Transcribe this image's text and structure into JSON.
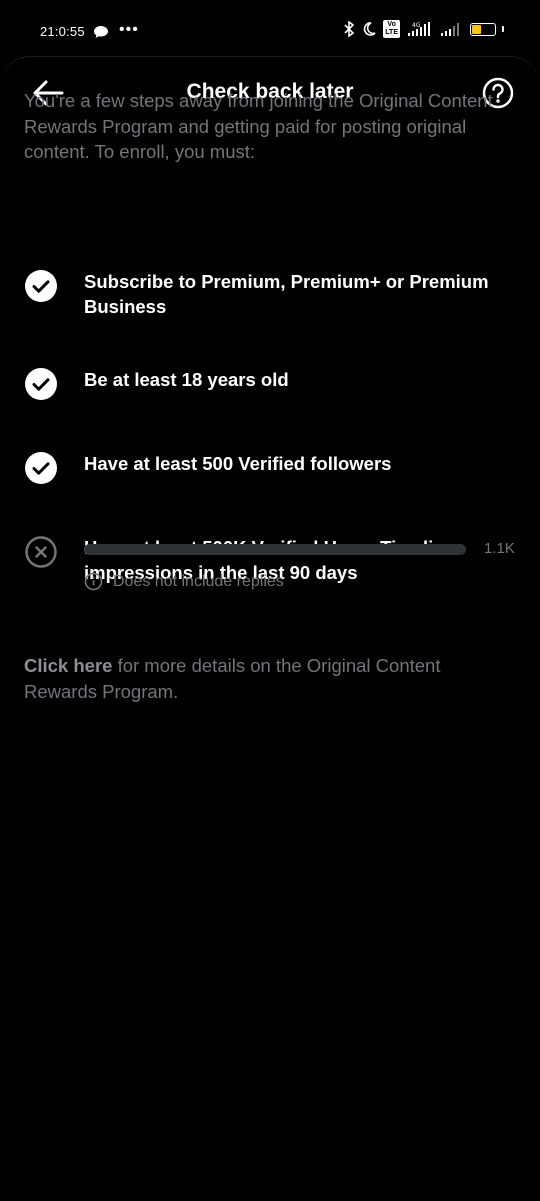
{
  "status_bar": {
    "time": "21:0:55",
    "network": "4G",
    "volte_label": "Vo\nLTE",
    "battery_level": 0.45,
    "battery_color": "#f5c518"
  },
  "header": {
    "title": "Check back later",
    "back_icon": "arrow-left-icon",
    "help_icon": "question-circle-icon"
  },
  "intro": "You're a few steps away from joining the Original Content Rewards Program and getting paid for posting original content. To enroll, you must:",
  "requirements": [
    {
      "label": "Subscribe to Premium, Premium+ or Premium Business",
      "status": "met",
      "icon": "check-circle-icon"
    },
    {
      "label": "Be at least 18 years old",
      "status": "met",
      "icon": "check-circle-icon"
    },
    {
      "label": "Have at least 500 Verified followers",
      "status": "met",
      "icon": "check-circle-icon"
    },
    {
      "label": "Have at least 500K Verified Home Timeline impressions in the last 90 days",
      "status": "unmet",
      "icon": "x-circle-icon"
    }
  ],
  "impressions": {
    "value_label": "1.1K",
    "progress": 0.0022,
    "note": "Does not include replies",
    "note_icon": "info-icon"
  },
  "footer": {
    "link_text": "Click here",
    "rest_text": " for more details on the Original Content Rewards Program."
  },
  "colors": {
    "background": "#000000",
    "primary_text": "#ffffff",
    "secondary_text": "#71767b",
    "track": "#2f3336"
  }
}
